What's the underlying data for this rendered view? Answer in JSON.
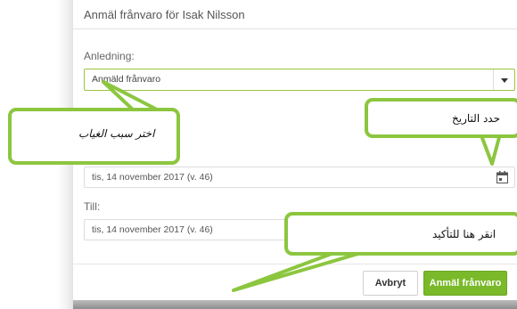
{
  "dialog": {
    "title": "Anmäl frånvaro för Isak Nilsson",
    "reason_label": "Anledning:",
    "reason_value": "Anmäld frånvaro",
    "from_value": "tis, 14 november 2017 (v. 46)",
    "to_label": "Till:",
    "to_value": "tis, 14 november 2017 (v. 46)",
    "cancel_label": "Avbryt",
    "submit_label": "Anmäl frånvaro"
  },
  "callouts": {
    "reason": "اختر سبب الغياب",
    "date": "حدد التاريخ",
    "confirm": "انقر هنا للتأكيد"
  },
  "colors": {
    "accent_green": "#8cc63f",
    "button_green": "#7ab929"
  },
  "icons": [
    "calendar-icon",
    "chevron-down-icon"
  ]
}
